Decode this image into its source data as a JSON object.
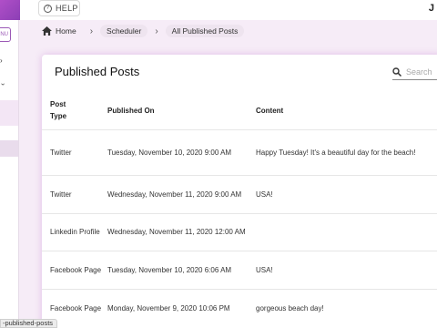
{
  "topbar": {
    "help_label": "HELP",
    "right_mark": "J"
  },
  "sidebar": {
    "menu_label": "NU"
  },
  "breadcrumb": [
    "Home",
    "Scheduler",
    "All Published Posts"
  ],
  "card": {
    "title": "Published Posts",
    "search_placeholder": "Search",
    "columns": {
      "type_line1": "Post",
      "type_line2": "Type",
      "published_on": "Published On",
      "content": "Content"
    },
    "rows": [
      {
        "type": "Twitter",
        "published_on": "Tuesday, November 10, 2020 9:00 AM",
        "content": "Happy Tuesday! It's a beautiful day for the beach!"
      },
      {
        "type": "Twitter",
        "published_on": "Wednesday, November 11, 2020 9:00 AM",
        "content": "USA!"
      },
      {
        "type": "Linkedin Profile",
        "published_on": "Wednesday, November 11, 2020 12:00 AM",
        "content": ""
      },
      {
        "type": "Facebook Page",
        "published_on": "Tuesday, November 10, 2020 6:06 AM",
        "content": "USA!"
      },
      {
        "type": "Facebook Page",
        "published_on": "Monday, November 9, 2020 10:06 PM",
        "content": "gorgeous beach day!"
      }
    ]
  },
  "status_url": "-published-posts",
  "colors": {
    "accent": "#9b59b6",
    "page_bg": "#f6ecf7"
  }
}
